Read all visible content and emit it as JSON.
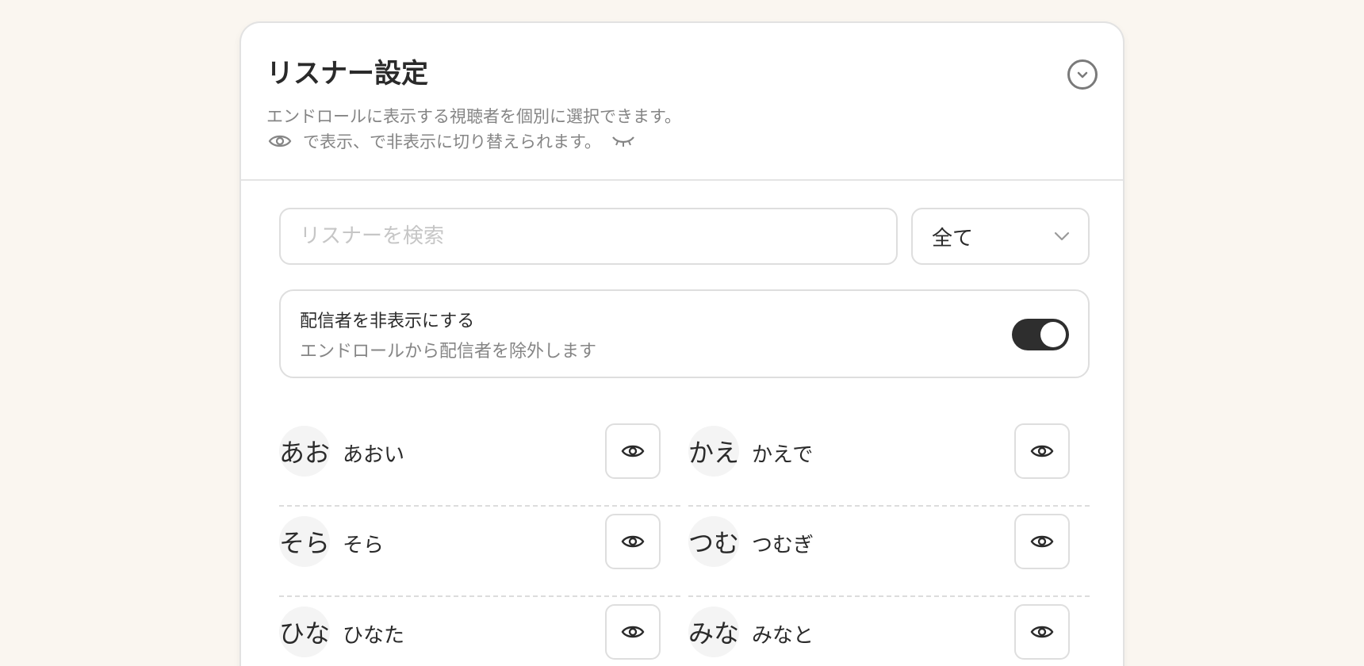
{
  "panel": {
    "title": "リスナー設定",
    "description_line1": "エンドロールに表示する視聴者を個別に選択できます。",
    "description_line2": "で表示、で非表示に切り替えられます。"
  },
  "search": {
    "placeholder": "リスナーを検索",
    "value": ""
  },
  "filter": {
    "selected": "全て"
  },
  "hide_streamer": {
    "title": "配信者を非表示にする",
    "subtitle": "エンドロールから配信者を除外します",
    "enabled": true
  },
  "listeners": [
    {
      "initials": "あお",
      "name": "あおい",
      "visible": true
    },
    {
      "initials": "かえ",
      "name": "かえで",
      "visible": true
    },
    {
      "initials": "そら",
      "name": "そら",
      "visible": true
    },
    {
      "initials": "つむ",
      "name": "つむぎ",
      "visible": true
    },
    {
      "initials": "ひな",
      "name": "ひなた",
      "visible": true
    },
    {
      "initials": "みな",
      "name": "みなと",
      "visible": true
    }
  ],
  "icons": {
    "visible": "eye-icon",
    "hidden": "eye-closed-icon",
    "collapse": "chevron-down-circle-icon",
    "dropdown": "chevron-down-icon"
  }
}
